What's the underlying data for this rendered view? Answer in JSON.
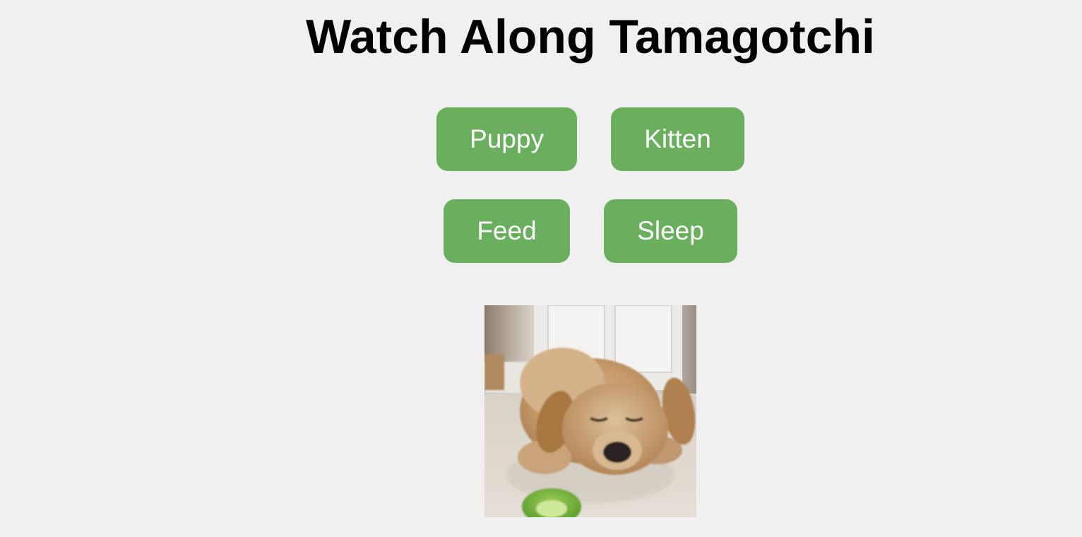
{
  "page": {
    "title": "Watch Along Tamagotchi"
  },
  "controls": {
    "pet_buttons": {
      "puppy": "Puppy",
      "kitten": "Kitten"
    },
    "action_buttons": {
      "feed": "Feed",
      "sleep": "Sleep"
    },
    "button_color": "#6aaf5e",
    "button_text_color": "#ffffff"
  },
  "pet_display": {
    "image_subject": "puppy-eating-image"
  },
  "colors": {
    "background": "#f0f0f0",
    "title": "#000000"
  }
}
